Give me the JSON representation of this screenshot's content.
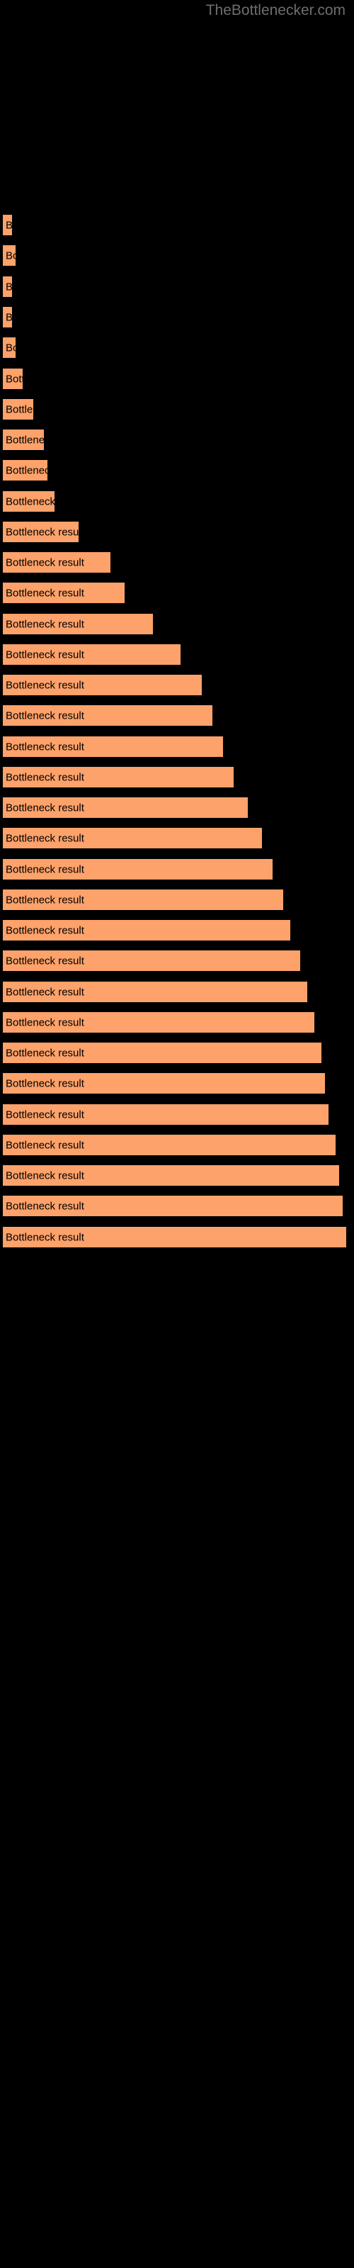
{
  "watermark": {
    "text": "TheBottlenecker.com",
    "color": "#6e6e6e"
  },
  "colors": {
    "background": "#000000",
    "bar_fill": "#FCA26A",
    "bar_edge": "#000000",
    "label_text": "#000000",
    "watermark_text": "#6e6e6e"
  },
  "chart_data": {
    "type": "bar",
    "orientation": "horizontal",
    "title": "",
    "xlabel": "",
    "ylabel": "",
    "grid": false,
    "legend": null,
    "xlim": [
      0,
      500
    ],
    "bar_label_text": "Bottleneck result",
    "categories": [
      "Bottleneck result",
      "Bottleneck result",
      "Bottleneck result",
      "Bottleneck result",
      "Bottleneck result",
      "Bottleneck result",
      "Bottleneck result",
      "Bottleneck result",
      "Bottleneck result",
      "Bottleneck result",
      "Bottleneck result",
      "Bottleneck result",
      "Bottleneck result",
      "Bottleneck result",
      "Bottleneck result",
      "Bottleneck result",
      "Bottleneck result",
      "Bottleneck result",
      "Bottleneck result",
      "Bottleneck result",
      "Bottleneck result",
      "Bottleneck result",
      "Bottleneck result",
      "Bottleneck result",
      "Bottleneck result",
      "Bottleneck result",
      "Bottleneck result",
      "Bottleneck result",
      "Bottleneck result",
      "Bottleneck result",
      "Bottleneck result",
      "Bottleneck result",
      "Bottleneck result",
      "Bottleneck result"
    ],
    "values": [
      3,
      4,
      3,
      3,
      4,
      6,
      9,
      12,
      13,
      15,
      22,
      31,
      35,
      43,
      51,
      57,
      60,
      63,
      66,
      70,
      74,
      77,
      80,
      82,
      85,
      87,
      89,
      91,
      92,
      93,
      95,
      96,
      97,
      98
    ],
    "bar_top_y": [
      302,
      345,
      389,
      432,
      475,
      519,
      562,
      605,
      648,
      692,
      735,
      778,
      821,
      865,
      908,
      951,
      994,
      1038,
      1081,
      1124,
      1167,
      1211,
      1254,
      1297,
      1340,
      1384,
      1427,
      1470,
      1513,
      1557,
      1600,
      1643,
      1686,
      1730
    ]
  }
}
